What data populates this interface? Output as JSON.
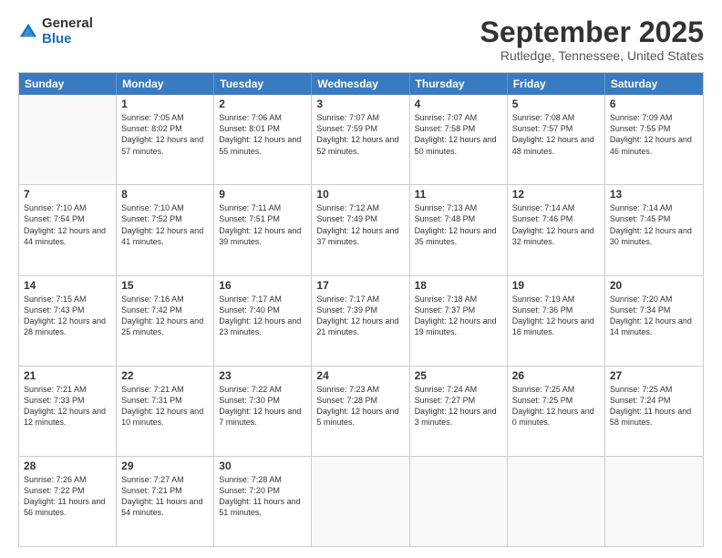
{
  "header": {
    "logo_general": "General",
    "logo_blue": "Blue",
    "title": "September 2025",
    "subtitle": "Rutledge, Tennessee, United States"
  },
  "days": [
    "Sunday",
    "Monday",
    "Tuesday",
    "Wednesday",
    "Thursday",
    "Friday",
    "Saturday"
  ],
  "weeks": [
    [
      {
        "day": "",
        "sunrise": "",
        "sunset": "",
        "daylight": ""
      },
      {
        "day": "1",
        "sunrise": "Sunrise: 7:05 AM",
        "sunset": "Sunset: 8:02 PM",
        "daylight": "Daylight: 12 hours and 57 minutes."
      },
      {
        "day": "2",
        "sunrise": "Sunrise: 7:06 AM",
        "sunset": "Sunset: 8:01 PM",
        "daylight": "Daylight: 12 hours and 55 minutes."
      },
      {
        "day": "3",
        "sunrise": "Sunrise: 7:07 AM",
        "sunset": "Sunset: 7:59 PM",
        "daylight": "Daylight: 12 hours and 52 minutes."
      },
      {
        "day": "4",
        "sunrise": "Sunrise: 7:07 AM",
        "sunset": "Sunset: 7:58 PM",
        "daylight": "Daylight: 12 hours and 50 minutes."
      },
      {
        "day": "5",
        "sunrise": "Sunrise: 7:08 AM",
        "sunset": "Sunset: 7:57 PM",
        "daylight": "Daylight: 12 hours and 48 minutes."
      },
      {
        "day": "6",
        "sunrise": "Sunrise: 7:09 AM",
        "sunset": "Sunset: 7:55 PM",
        "daylight": "Daylight: 12 hours and 46 minutes."
      }
    ],
    [
      {
        "day": "7",
        "sunrise": "Sunrise: 7:10 AM",
        "sunset": "Sunset: 7:54 PM",
        "daylight": "Daylight: 12 hours and 44 minutes."
      },
      {
        "day": "8",
        "sunrise": "Sunrise: 7:10 AM",
        "sunset": "Sunset: 7:52 PM",
        "daylight": "Daylight: 12 hours and 41 minutes."
      },
      {
        "day": "9",
        "sunrise": "Sunrise: 7:11 AM",
        "sunset": "Sunset: 7:51 PM",
        "daylight": "Daylight: 12 hours and 39 minutes."
      },
      {
        "day": "10",
        "sunrise": "Sunrise: 7:12 AM",
        "sunset": "Sunset: 7:49 PM",
        "daylight": "Daylight: 12 hours and 37 minutes."
      },
      {
        "day": "11",
        "sunrise": "Sunrise: 7:13 AM",
        "sunset": "Sunset: 7:48 PM",
        "daylight": "Daylight: 12 hours and 35 minutes."
      },
      {
        "day": "12",
        "sunrise": "Sunrise: 7:14 AM",
        "sunset": "Sunset: 7:46 PM",
        "daylight": "Daylight: 12 hours and 32 minutes."
      },
      {
        "day": "13",
        "sunrise": "Sunrise: 7:14 AM",
        "sunset": "Sunset: 7:45 PM",
        "daylight": "Daylight: 12 hours and 30 minutes."
      }
    ],
    [
      {
        "day": "14",
        "sunrise": "Sunrise: 7:15 AM",
        "sunset": "Sunset: 7:43 PM",
        "daylight": "Daylight: 12 hours and 28 minutes."
      },
      {
        "day": "15",
        "sunrise": "Sunrise: 7:16 AM",
        "sunset": "Sunset: 7:42 PM",
        "daylight": "Daylight: 12 hours and 25 minutes."
      },
      {
        "day": "16",
        "sunrise": "Sunrise: 7:17 AM",
        "sunset": "Sunset: 7:40 PM",
        "daylight": "Daylight: 12 hours and 23 minutes."
      },
      {
        "day": "17",
        "sunrise": "Sunrise: 7:17 AM",
        "sunset": "Sunset: 7:39 PM",
        "daylight": "Daylight: 12 hours and 21 minutes."
      },
      {
        "day": "18",
        "sunrise": "Sunrise: 7:18 AM",
        "sunset": "Sunset: 7:37 PM",
        "daylight": "Daylight: 12 hours and 19 minutes."
      },
      {
        "day": "19",
        "sunrise": "Sunrise: 7:19 AM",
        "sunset": "Sunset: 7:36 PM",
        "daylight": "Daylight: 12 hours and 16 minutes."
      },
      {
        "day": "20",
        "sunrise": "Sunrise: 7:20 AM",
        "sunset": "Sunset: 7:34 PM",
        "daylight": "Daylight: 12 hours and 14 minutes."
      }
    ],
    [
      {
        "day": "21",
        "sunrise": "Sunrise: 7:21 AM",
        "sunset": "Sunset: 7:33 PM",
        "daylight": "Daylight: 12 hours and 12 minutes."
      },
      {
        "day": "22",
        "sunrise": "Sunrise: 7:21 AM",
        "sunset": "Sunset: 7:31 PM",
        "daylight": "Daylight: 12 hours and 10 minutes."
      },
      {
        "day": "23",
        "sunrise": "Sunrise: 7:22 AM",
        "sunset": "Sunset: 7:30 PM",
        "daylight": "Daylight: 12 hours and 7 minutes."
      },
      {
        "day": "24",
        "sunrise": "Sunrise: 7:23 AM",
        "sunset": "Sunset: 7:28 PM",
        "daylight": "Daylight: 12 hours and 5 minutes."
      },
      {
        "day": "25",
        "sunrise": "Sunrise: 7:24 AM",
        "sunset": "Sunset: 7:27 PM",
        "daylight": "Daylight: 12 hours and 3 minutes."
      },
      {
        "day": "26",
        "sunrise": "Sunrise: 7:25 AM",
        "sunset": "Sunset: 7:25 PM",
        "daylight": "Daylight: 12 hours and 0 minutes."
      },
      {
        "day": "27",
        "sunrise": "Sunrise: 7:25 AM",
        "sunset": "Sunset: 7:24 PM",
        "daylight": "Daylight: 11 hours and 58 minutes."
      }
    ],
    [
      {
        "day": "28",
        "sunrise": "Sunrise: 7:26 AM",
        "sunset": "Sunset: 7:22 PM",
        "daylight": "Daylight: 11 hours and 56 minutes."
      },
      {
        "day": "29",
        "sunrise": "Sunrise: 7:27 AM",
        "sunset": "Sunset: 7:21 PM",
        "daylight": "Daylight: 11 hours and 54 minutes."
      },
      {
        "day": "30",
        "sunrise": "Sunrise: 7:28 AM",
        "sunset": "Sunset: 7:20 PM",
        "daylight": "Daylight: 11 hours and 51 minutes."
      },
      {
        "day": "",
        "sunrise": "",
        "sunset": "",
        "daylight": ""
      },
      {
        "day": "",
        "sunrise": "",
        "sunset": "",
        "daylight": ""
      },
      {
        "day": "",
        "sunrise": "",
        "sunset": "",
        "daylight": ""
      },
      {
        "day": "",
        "sunrise": "",
        "sunset": "",
        "daylight": ""
      }
    ]
  ]
}
